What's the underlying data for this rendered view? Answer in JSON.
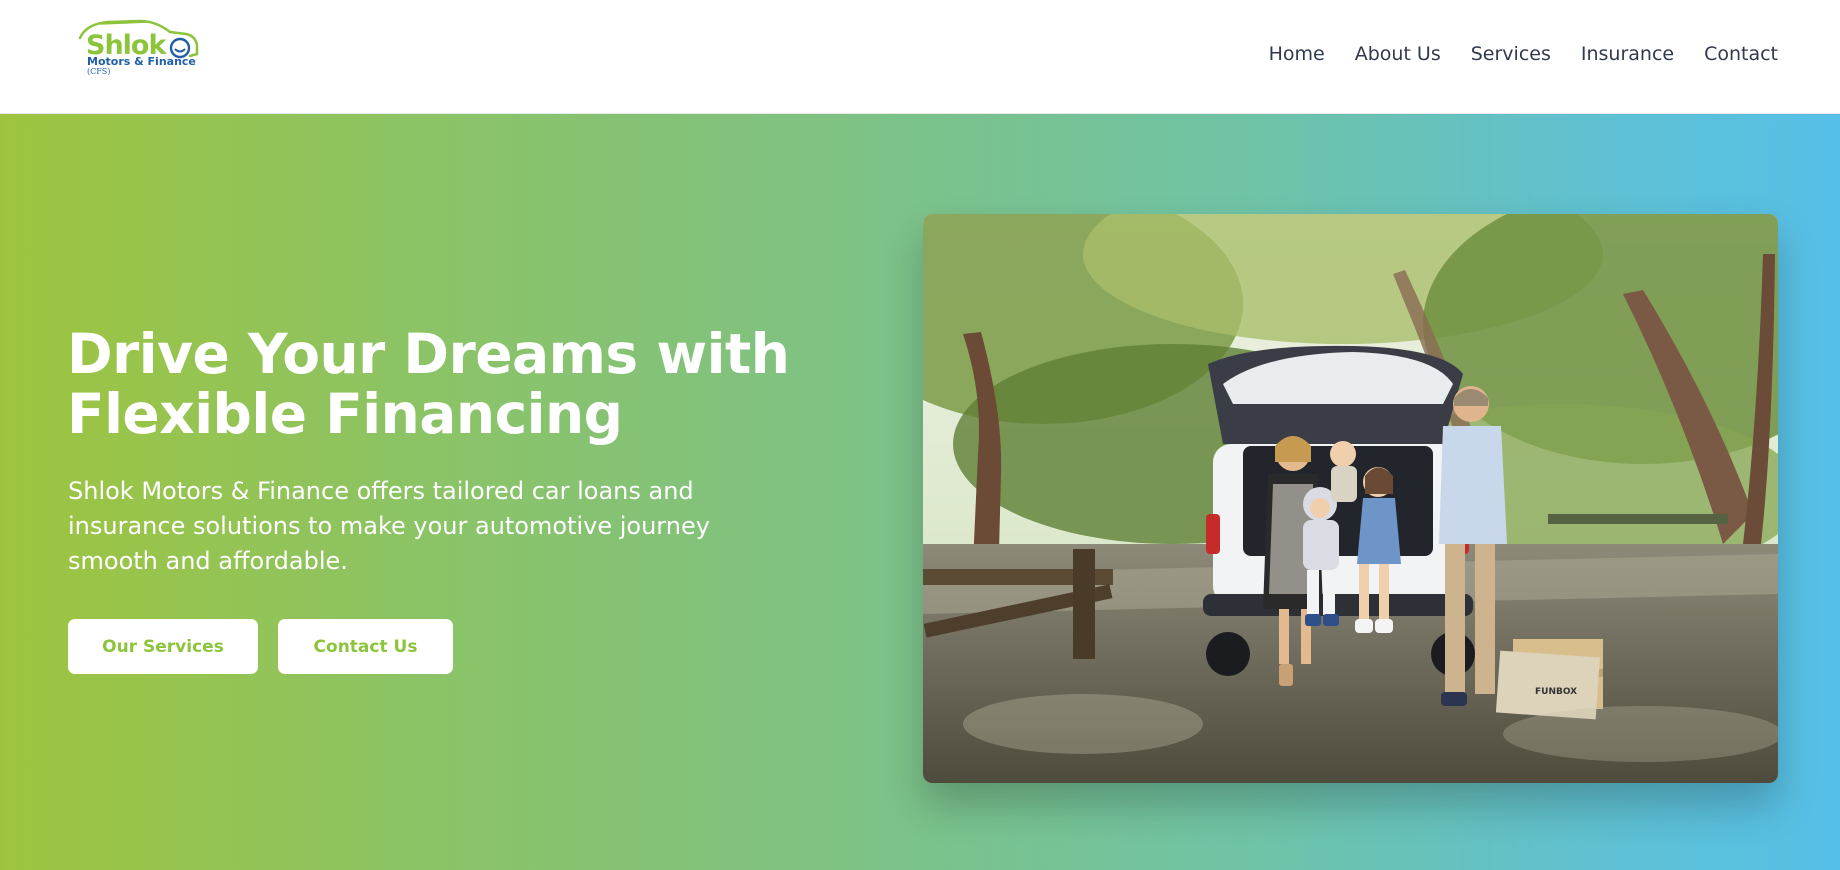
{
  "brand": {
    "logo_main": "Shlok",
    "logo_sub": "Motors & Finance",
    "logo_tag": "(CFS)"
  },
  "nav": {
    "items": [
      {
        "label": "Home"
      },
      {
        "label": "About Us"
      },
      {
        "label": "Services"
      },
      {
        "label": "Insurance"
      },
      {
        "label": "Contact"
      }
    ]
  },
  "hero": {
    "title": "Drive Your Dreams with Flexible Financing",
    "subtitle": "Shlok Motors & Finance offers tailored car loans and insurance solutions to make your automotive journey smooth and affordable.",
    "primary_button": "Our Services",
    "secondary_button": "Contact Us",
    "image_box_label": "FUNBOX"
  },
  "colors": {
    "brand_green": "#8cc43c",
    "brand_blue": "#1f5fa8",
    "gradient_start": "#9ec43f",
    "gradient_end": "#56bfe8",
    "nav_text": "#2f3a4c"
  },
  "icons": {
    "logo": "car-outline-logo-icon"
  }
}
